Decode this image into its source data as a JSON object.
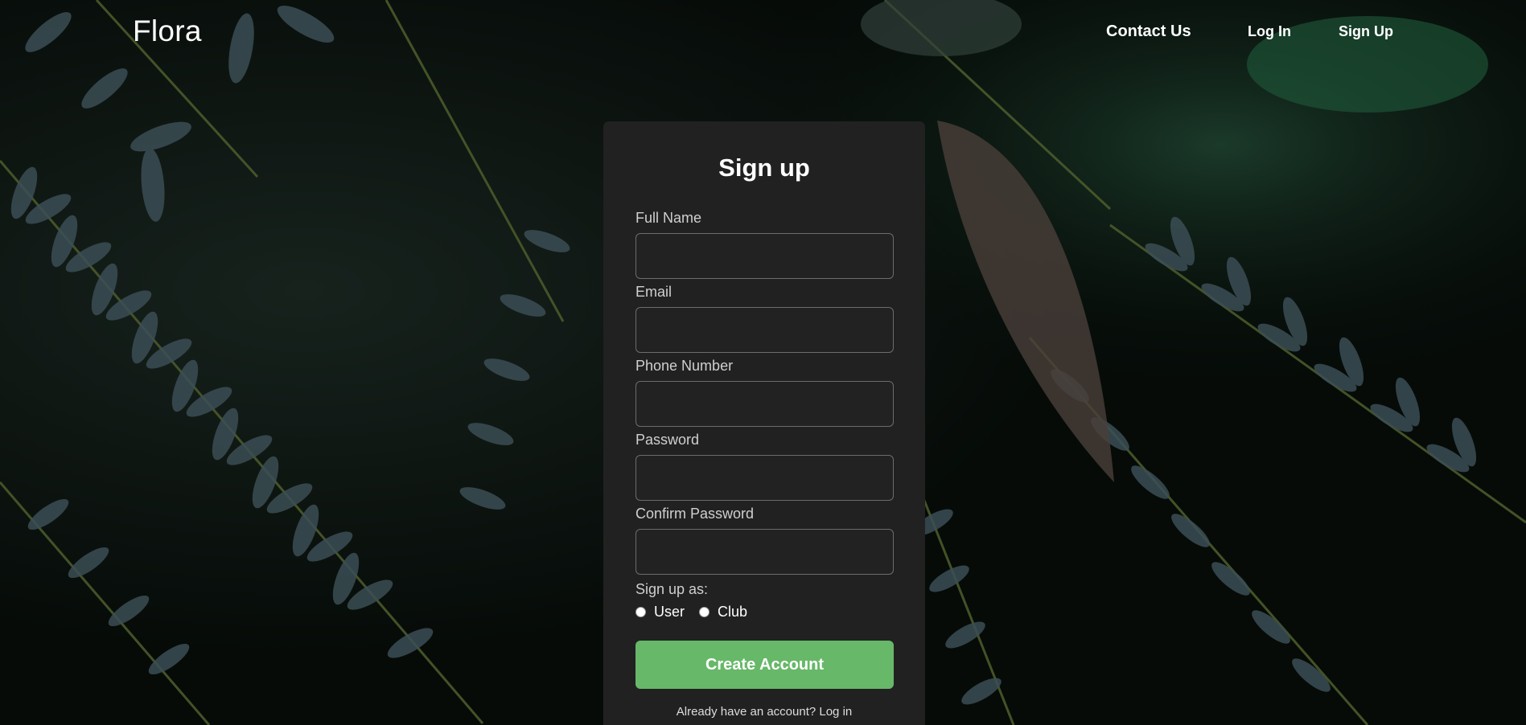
{
  "header": {
    "logo": "Flora",
    "nav": {
      "contact": "Contact Us",
      "login": "Log In",
      "signup": "Sign Up"
    }
  },
  "form": {
    "title": "Sign up",
    "fields": [
      {
        "label": "Full Name",
        "value": "",
        "placeholder": ""
      },
      {
        "label": "Email",
        "value": "",
        "placeholder": ""
      },
      {
        "label": "Phone Number",
        "value": "",
        "placeholder": ""
      },
      {
        "label": "Password",
        "value": "",
        "placeholder": ""
      },
      {
        "label": "Confirm Password",
        "value": "",
        "placeholder": ""
      }
    ],
    "signup_as_label": "Sign up as:",
    "roles": [
      "User",
      "Club"
    ],
    "submit_label": "Create Account",
    "login_hint": "Already have an account? Log in"
  },
  "colors": {
    "card_bg": "#212121",
    "accent_green": "#67b869",
    "field_border": "#6c6c6c"
  },
  "icons": {
    "background": "fern-leaves-photo"
  }
}
